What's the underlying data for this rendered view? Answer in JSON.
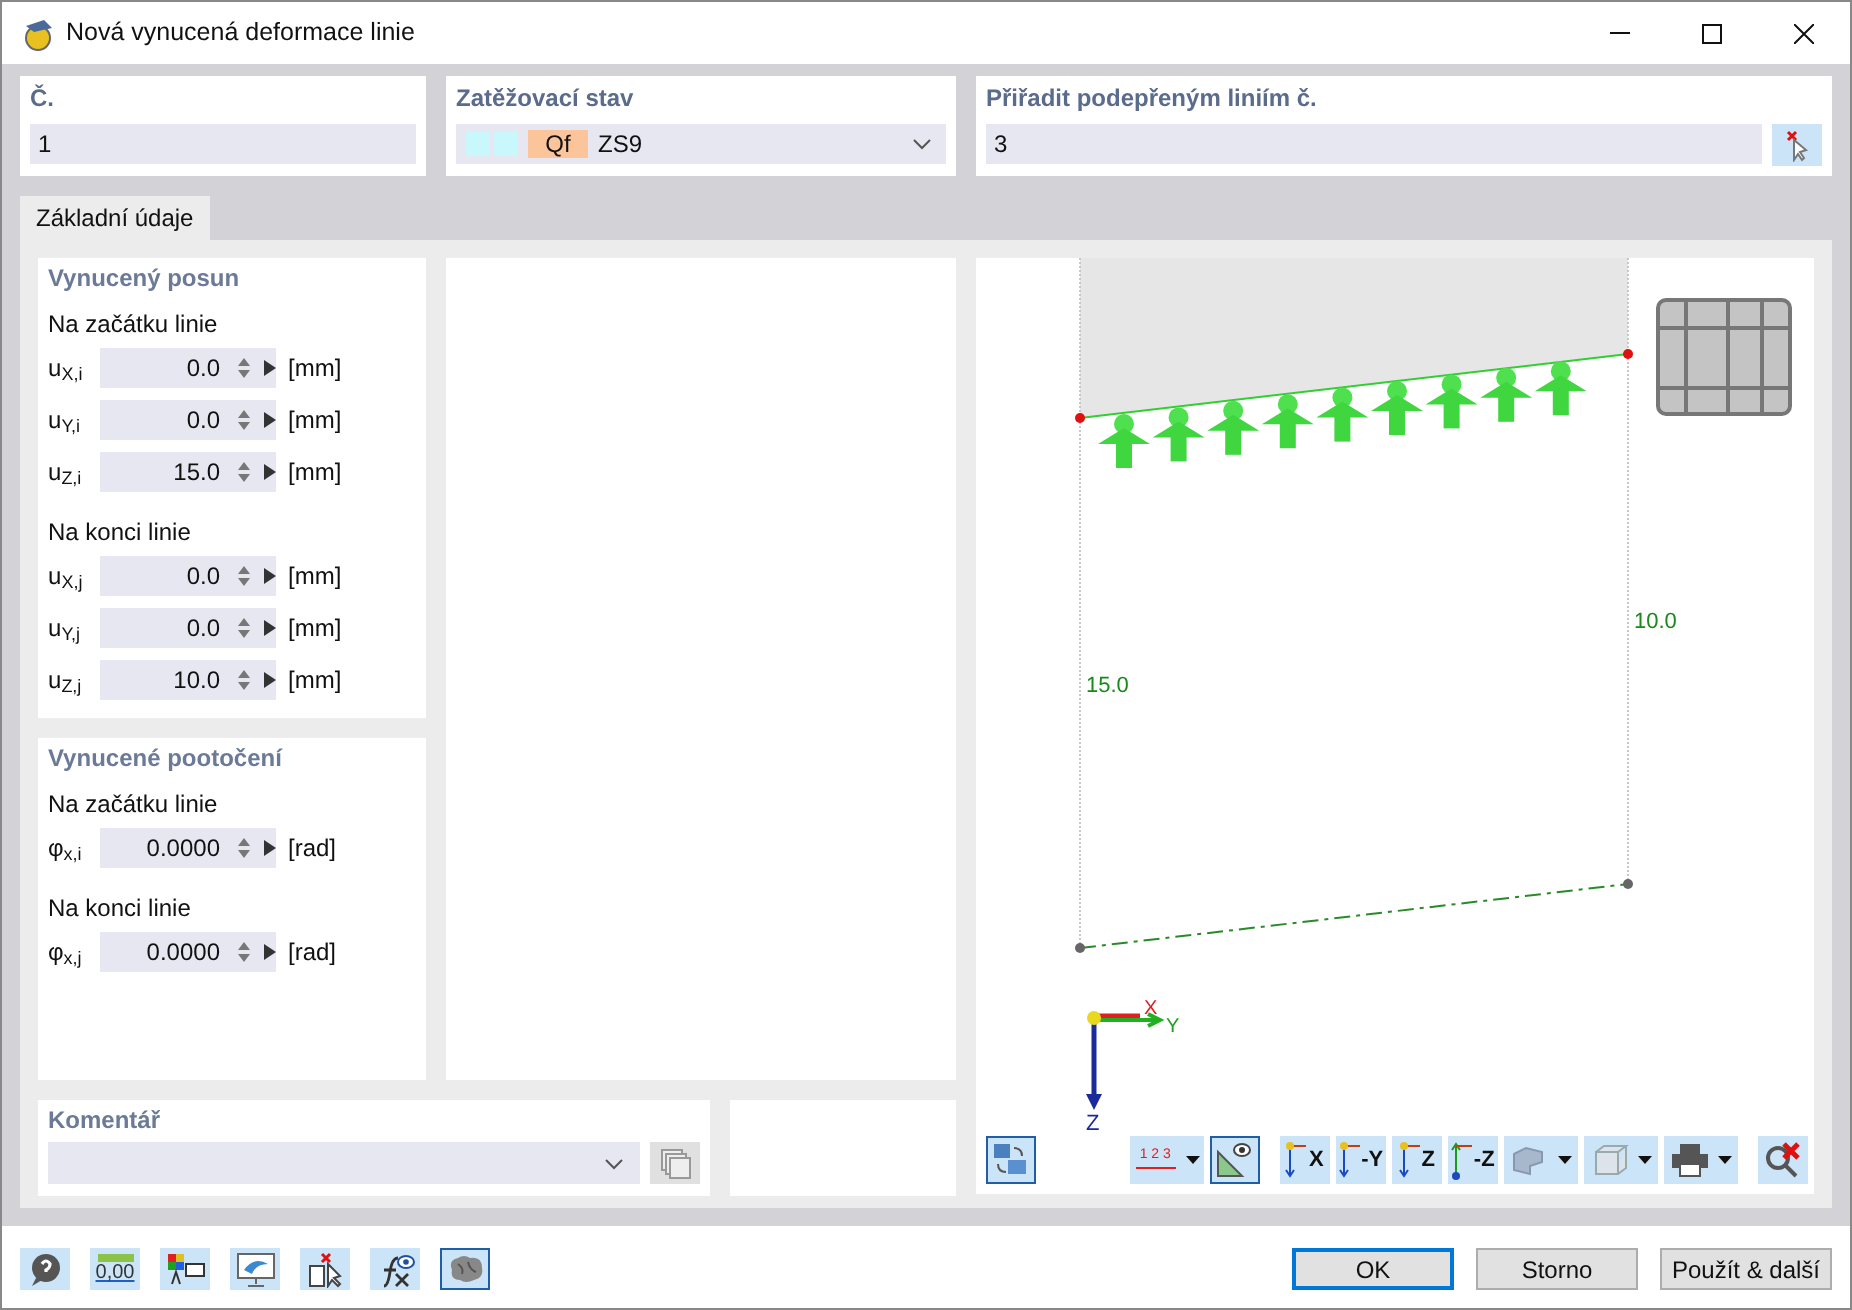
{
  "window": {
    "title": "Nová vynucená deformace linie"
  },
  "number": {
    "label": "Č.",
    "value": "1"
  },
  "load_case": {
    "label": "Zatěžovací stav",
    "tag": "Qf",
    "value": "ZS9"
  },
  "assign_lines": {
    "label": "Přiřadit podepřeným liniím č.",
    "value": "3"
  },
  "tabs": [
    {
      "label": "Základní údaje",
      "selected": true
    }
  ],
  "sections": [
    {
      "title": "Vynucený posun",
      "groups": [
        {
          "title": "Na začátku linie",
          "rows": [
            {
              "symbol": "u$_{X,i}$",
              "value": "0.0",
              "unit": "[mm]"
            },
            {
              "symbol": "u$_{Y,i}$",
              "value": "0.0",
              "unit": "[mm]"
            },
            {
              "symbol": "u$_{Z,i}$",
              "value": "15.0",
              "unit": "[mm]"
            }
          ]
        },
        {
          "title": "Na konci linie",
          "rows": [
            {
              "symbol": "u$_{X,j}$",
              "value": "0.0",
              "unit": "[mm]"
            },
            {
              "symbol": "u$_{Y,j}$",
              "value": "0.0",
              "unit": "[mm]"
            },
            {
              "symbol": "u$_{Z,j}$",
              "value": "10.0",
              "unit": "[mm]"
            }
          ]
        }
      ]
    },
    {
      "title": "Vynucené pootočení",
      "groups": [
        {
          "title": "Na začátku linie",
          "rows": [
            {
              "symbol": "φ$_{x,i}$",
              "value": "0.0000",
              "unit": "[rad]"
            }
          ]
        },
        {
          "title": "Na konci linie",
          "rows": [
            {
              "symbol": "φ$_{x,j}$",
              "value": "0.0000",
              "unit": "[rad]"
            }
          ]
        }
      ]
    }
  ],
  "viewport": {
    "start_label": "15.0",
    "end_label": "10.0",
    "axes": [
      "X",
      "Y",
      "Z"
    ]
  },
  "view_tools": [
    {
      "kind": "rotate",
      "selected": true,
      "dropdown": false
    },
    {
      "kind": "numbering",
      "text": "1 2 3",
      "selected": false,
      "dropdown": true
    },
    {
      "kind": "visibility",
      "selected": true,
      "dropdown": false
    },
    {
      "kind": "axis",
      "text": "X",
      "selected": false,
      "dropdown": false
    },
    {
      "kind": "axis",
      "text": "-Y",
      "selected": false,
      "dropdown": false
    },
    {
      "kind": "axis",
      "text": "Z",
      "selected": false,
      "dropdown": false
    },
    {
      "kind": "axis-up",
      "text": "-Z",
      "selected": false,
      "dropdown": false
    },
    {
      "kind": "render",
      "selected": false,
      "dropdown": true
    },
    {
      "kind": "wireframe",
      "selected": false,
      "dropdown": true
    },
    {
      "kind": "print",
      "selected": false,
      "dropdown": true
    },
    {
      "kind": "zoom-reset",
      "selected": false,
      "dropdown": false
    }
  ],
  "comment": {
    "label": "Komentář"
  },
  "footer_tools": [
    {
      "kind": "help",
      "selected": false
    },
    {
      "kind": "units",
      "text": "0,00",
      "selected": false
    },
    {
      "kind": "colors",
      "selected": false
    },
    {
      "kind": "display",
      "selected": false
    },
    {
      "kind": "pick",
      "selected": false
    },
    {
      "kind": "formula",
      "selected": false
    },
    {
      "kind": "brain",
      "selected": true
    }
  ],
  "buttons": [
    {
      "label": "OK",
      "default": true
    },
    {
      "label": "Storno",
      "default": false
    },
    {
      "label": "Použít & další",
      "default": false
    }
  ]
}
